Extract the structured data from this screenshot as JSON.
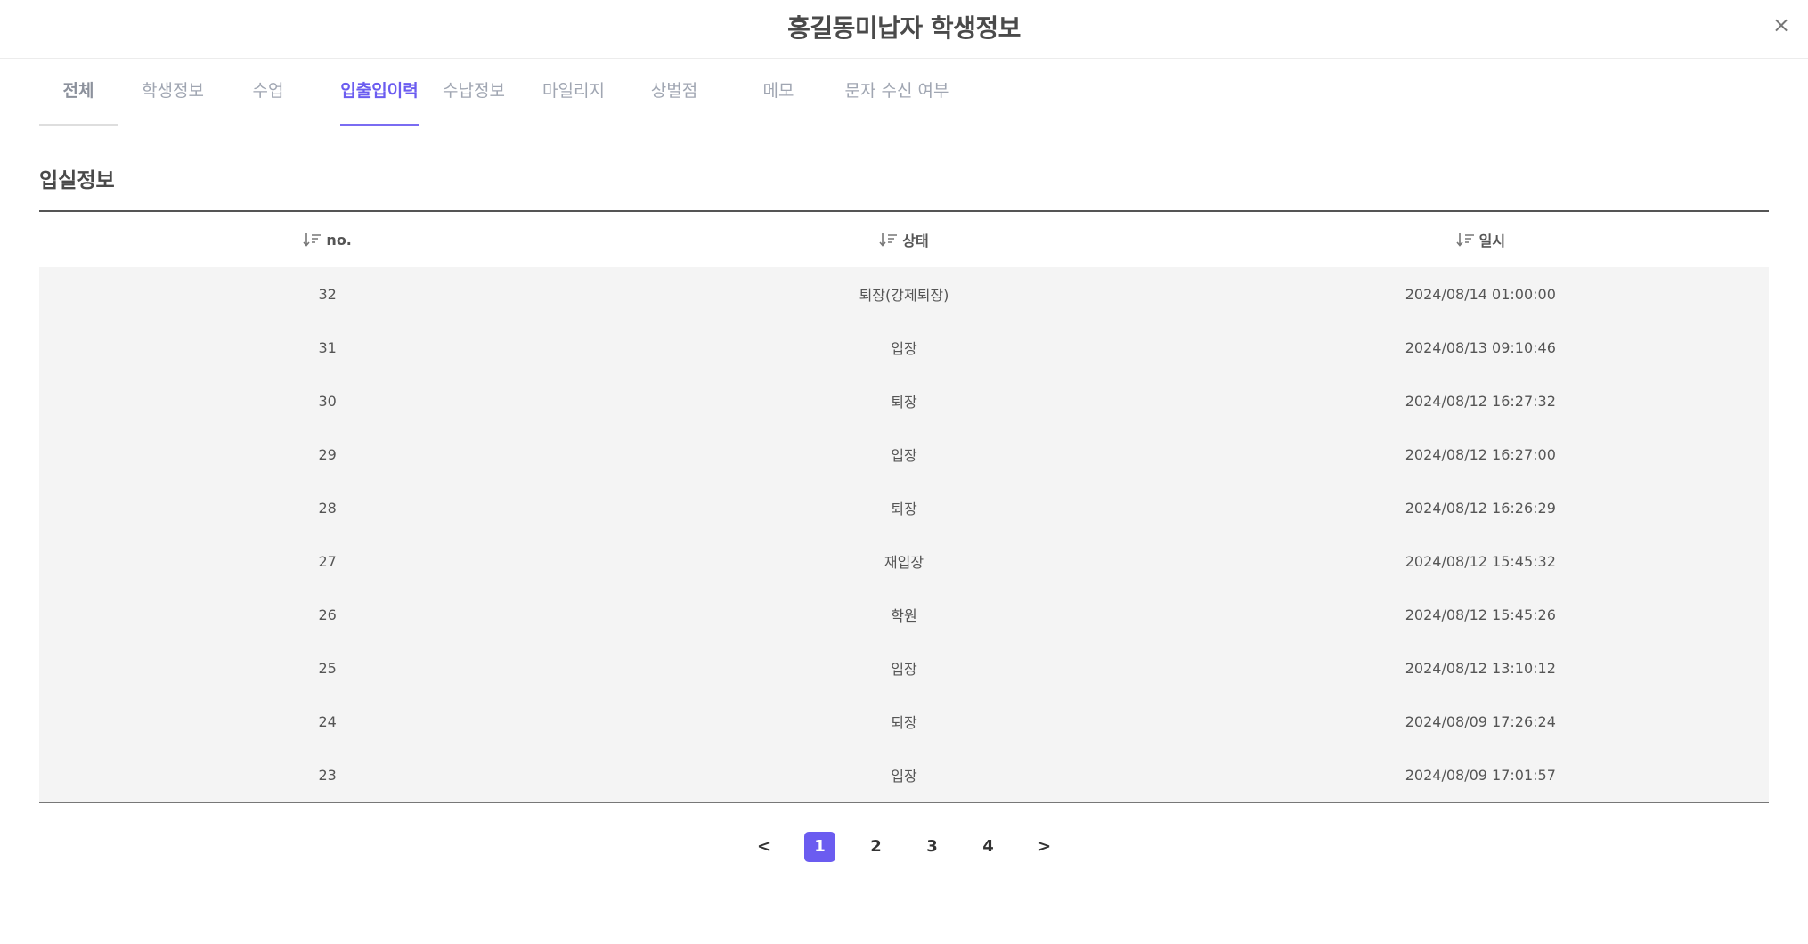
{
  "header": {
    "title": "홍길동미납자 학생정보",
    "close_icon": "×"
  },
  "tabs": [
    {
      "label": "전체"
    },
    {
      "label": "학생정보"
    },
    {
      "label": "수업"
    },
    {
      "label": "입출입이력"
    },
    {
      "label": "수납정보"
    },
    {
      "label": "마일리지"
    },
    {
      "label": "상벌점"
    },
    {
      "label": "메모"
    },
    {
      "label": "문자 수신 여부"
    }
  ],
  "active_tab": "입출입이력",
  "section": {
    "title": "입실정보"
  },
  "table": {
    "columns": [
      "no.",
      "상태",
      "일시"
    ],
    "rows": [
      {
        "no": "32",
        "status": "퇴장(강제퇴장)",
        "datetime": "2024/08/14 01:00:00"
      },
      {
        "no": "31",
        "status": "입장",
        "datetime": "2024/08/13 09:10:46"
      },
      {
        "no": "30",
        "status": "퇴장",
        "datetime": "2024/08/12 16:27:32"
      },
      {
        "no": "29",
        "status": "입장",
        "datetime": "2024/08/12 16:27:00"
      },
      {
        "no": "28",
        "status": "퇴장",
        "datetime": "2024/08/12 16:26:29"
      },
      {
        "no": "27",
        "status": "재입장",
        "datetime": "2024/08/12 15:45:32"
      },
      {
        "no": "26",
        "status": "학원",
        "datetime": "2024/08/12 15:45:26"
      },
      {
        "no": "25",
        "status": "입장",
        "datetime": "2024/08/12 13:10:12"
      },
      {
        "no": "24",
        "status": "퇴장",
        "datetime": "2024/08/09 17:26:24"
      },
      {
        "no": "23",
        "status": "입장",
        "datetime": "2024/08/09 17:01:57"
      }
    ]
  },
  "pagination": {
    "prev": "<",
    "next": ">",
    "pages": [
      "1",
      "2",
      "3",
      "4"
    ],
    "current": "1"
  },
  "colors": {
    "accent": "#6b5cf0",
    "row_bg": "#f4f4f4"
  }
}
